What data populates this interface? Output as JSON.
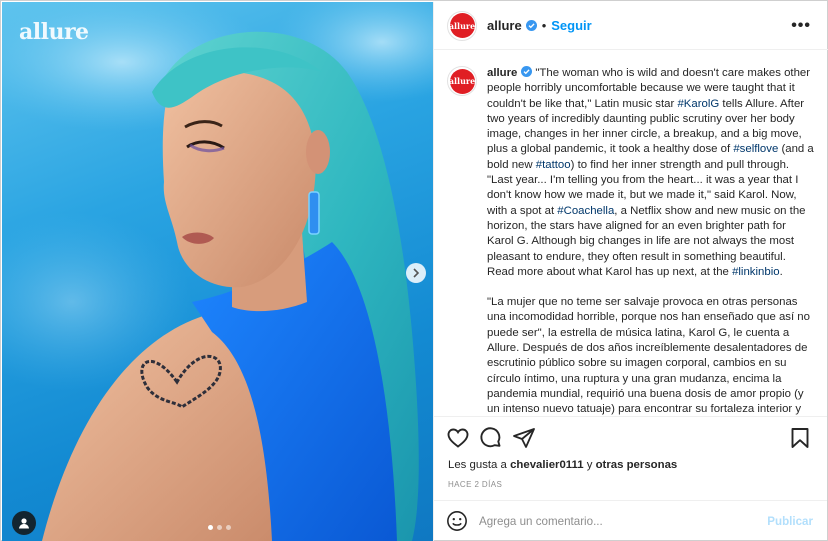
{
  "media": {
    "watermark": "allure",
    "carousel": {
      "count": 3,
      "active": 0
    },
    "icons": {
      "next": "chevron-right-icon",
      "tag": "user-tag-icon"
    }
  },
  "header": {
    "username": "allure",
    "separator": "•",
    "follow_label": "Seguir",
    "more_label": "•••",
    "avatar_text": "allure"
  },
  "caption": {
    "username": "allure",
    "segments": [
      {
        "t": "\"The woman who is wild and doesn't care makes other people horribly uncomfortable because we were taught that it couldn't be like that,\" Latin music star "
      },
      {
        "t": "#KarolG",
        "tag": true
      },
      {
        "t": " tells Allure. After two years of incredibly daunting public scrutiny over her body image, changes in her inner circle, a breakup, and a big move, plus a global pandemic, it took a healthy dose of "
      },
      {
        "t": "#selflove",
        "tag": true
      },
      {
        "t": " (and a bold new "
      },
      {
        "t": "#tattoo",
        "tag": true
      },
      {
        "t": ") to find her inner strength and pull through. \"Last year... I'm telling you from the heart... it was a year that I don't know how we made it, but we made it,\" said Karol. Now, with a spot at "
      },
      {
        "t": "#Coachella",
        "tag": true
      },
      {
        "t": ", a Netflix show and new music on the horizon, the stars have aligned for an even brighter path for Karol G. Although big changes in life are not always the most pleasant to endure, they often result in something beautiful. Read more about what Karol has up next, at the "
      },
      {
        "t": "#linkinbio",
        "tag": true
      },
      {
        "t": "."
      }
    ],
    "spanish": "\"La mujer que no teme ser salvaje provoca en otras personas una incomodidad horrible, porque nos han enseñado que así no puede ser\", la estrella de música latina, Karol G, le cuenta a Allure. Después de dos años increíblemente desalentadores de escrutinio público sobre su imagen corporal, cambios en su círculo íntimo, una ruptura y una gran mudanza, encima la pandemia mundial, requirió una buena dosis de amor propio (y un intenso nuevo tatuaje) para encontrar su fortaleza interior y salir adelante. \"El año pasado...te lo digo de corazón...fue un año que no sé cómo lo hicimos, pero lo logramos\", dijo Karol."
  },
  "actions": {
    "icons": [
      "heart-icon",
      "comment-icon",
      "share-icon",
      "bookmark-icon"
    ]
  },
  "likes": {
    "prefix": "Les gusta a ",
    "user": "chevalier0111",
    "mid": " y ",
    "others": "otras personas"
  },
  "timestamp": "HACE 2 DÍAS",
  "comment_box": {
    "placeholder": "Agrega un comentario...",
    "post_label": "Publicar"
  },
  "colors": {
    "accent": "#0095f6",
    "hashtag": "#00376b",
    "brand_red": "#e01e24",
    "post_disabled": "#b2dffc"
  }
}
